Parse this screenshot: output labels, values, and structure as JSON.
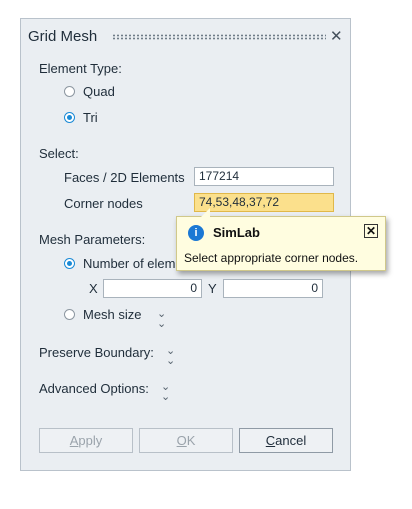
{
  "dialog": {
    "title": "Grid Mesh",
    "close_glyph": "✕"
  },
  "element_type": {
    "label": "Element Type:",
    "options": [
      {
        "label": "Quad",
        "selected": false
      },
      {
        "label": "Tri",
        "selected": true
      }
    ]
  },
  "select": {
    "label": "Select:",
    "faces_label": "Faces / 2D Elements",
    "faces_value": "177214",
    "corner_label": "Corner nodes",
    "corner_value": "74,53,48,37,72"
  },
  "mesh_parameters": {
    "label": "Mesh Parameters:",
    "number_label": "Number of elem",
    "number_selected": true,
    "x_label": "X",
    "x_value": "0",
    "y_label": "Y",
    "y_value": "0",
    "mesh_size_label": "Mesh size",
    "mesh_size_selected": false
  },
  "preserve_boundary": {
    "label": "Preserve Boundary:"
  },
  "advanced_options": {
    "label": "Advanced Options:"
  },
  "buttons": {
    "apply": {
      "label": "Apply",
      "underline": "A",
      "rest": "pply",
      "enabled": false
    },
    "ok": {
      "label": "OK",
      "underline": "O",
      "rest": "K",
      "enabled": false
    },
    "cancel": {
      "label": "Cancel",
      "underline": "C",
      "rest": "ancel",
      "enabled": true
    }
  },
  "tooltip": {
    "icon": "info-icon",
    "title": "SimLab",
    "message": "Select appropriate corner nodes.",
    "close_glyph": "✕"
  },
  "colors": {
    "panel_bg": "#eaeef2",
    "accent": "#1a8ad6",
    "highlight_field": "#fbe08c",
    "tooltip_bg": "#fffde0",
    "info_blue": "#1b78d4"
  }
}
